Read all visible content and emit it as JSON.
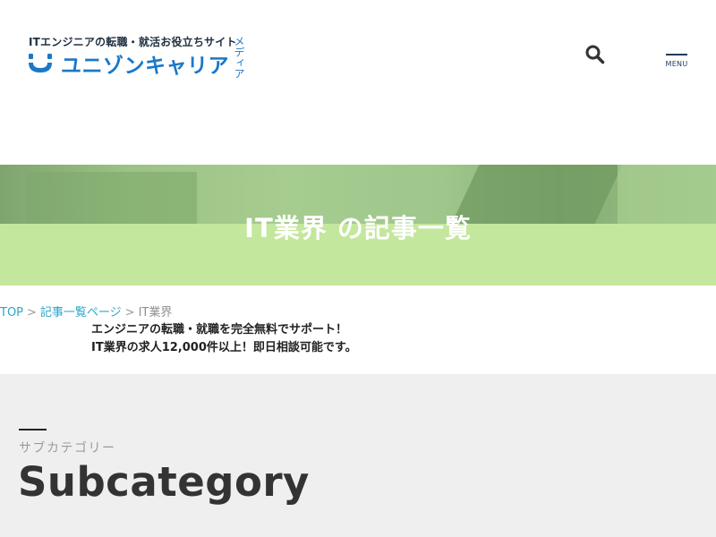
{
  "header": {
    "tagline": "ITエンジニアの転職・就活お役立ちサイト",
    "site_name": "ユニゾンキャリア",
    "site_suffix": "メディア",
    "search_icon": "search-icon",
    "menu_label": "MENU"
  },
  "hero": {
    "title": "IT業界 の記事一覧"
  },
  "breadcrumb": {
    "items": [
      "TOP",
      "記事一覧ページ",
      "IT業界"
    ],
    "separator": ">"
  },
  "promo": {
    "line1": "エンジニアの転職・就職を完全無料でサポート！",
    "line2": "IT業界の求人12,000件以上！即日相談可能です。"
  },
  "subcategory": {
    "kana": "サブカテゴリー",
    "title": "Subcategory"
  },
  "colors": {
    "brand_blue": "#1a78c8",
    "hero_band": "#c3e79c",
    "link": "#2aa7c9",
    "section_bg": "#efefef"
  }
}
